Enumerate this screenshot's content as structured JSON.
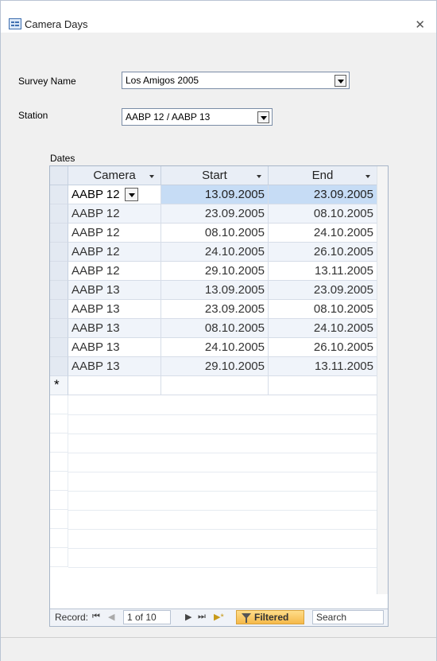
{
  "window": {
    "title": "Camera Days"
  },
  "form": {
    "survey_label": "Survey Name",
    "survey_value": "Los Amigos 2005",
    "station_label": "Station",
    "station_value": "AABP 12 / AABP 13",
    "dates_label": "Dates"
  },
  "grid": {
    "columns": [
      "Camera",
      "Start",
      "End"
    ],
    "rows": [
      [
        "AABP 12",
        "13.09.2005",
        "23.09.2005"
      ],
      [
        "AABP 12",
        "23.09.2005",
        "08.10.2005"
      ],
      [
        "AABP 12",
        "08.10.2005",
        "24.10.2005"
      ],
      [
        "AABP 12",
        "24.10.2005",
        "26.10.2005"
      ],
      [
        "AABP 12",
        "29.10.2005",
        "13.11.2005"
      ],
      [
        "AABP 13",
        "13.09.2005",
        "23.09.2005"
      ],
      [
        "AABP 13",
        "23.09.2005",
        "08.10.2005"
      ],
      [
        "AABP 13",
        "08.10.2005",
        "24.10.2005"
      ],
      [
        "AABP 13",
        "24.10.2005",
        "26.10.2005"
      ],
      [
        "AABP 13",
        "29.10.2005",
        "13.11.2005"
      ]
    ],
    "new_row_marker": "*"
  },
  "navigation": {
    "record_label": "Record:",
    "current": "1 of 10",
    "filtered_label": "Filtered",
    "search_label": "Search",
    "first_symbol": "⏮",
    "prev_symbol": "◀",
    "next_symbol": "▶",
    "last_symbol": "⏭",
    "new_symbol": "▶*"
  },
  "colors": {
    "selection": "#c6dcf5",
    "header": "#e9eef6",
    "filtered": "#f5b94a"
  }
}
